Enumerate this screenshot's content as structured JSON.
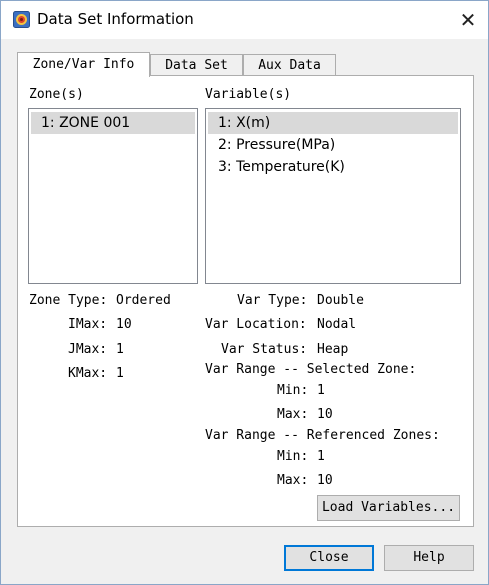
{
  "window": {
    "title": "Data Set Information"
  },
  "tabs": [
    {
      "label": "Zone/Var Info",
      "active": true
    },
    {
      "label": "Data Set",
      "active": false
    },
    {
      "label": "Aux Data",
      "active": false
    }
  ],
  "zones": {
    "header": "Zone(s)",
    "items": [
      {
        "label": "1: ZONE 001",
        "selected": true
      }
    ]
  },
  "variables": {
    "header": "Variable(s)",
    "items": [
      {
        "label": "1: X(m)",
        "selected": true
      },
      {
        "label": "2: Pressure(MPa)",
        "selected": false
      },
      {
        "label": "3: Temperature(K)",
        "selected": false
      }
    ]
  },
  "zone_info": {
    "type_label": "Zone Type:",
    "type_value": "Ordered",
    "imax_label": "IMax:",
    "imax_value": "10",
    "jmax_label": "JMax:",
    "jmax_value": "1",
    "kmax_label": "KMax:",
    "kmax_value": "1"
  },
  "var_info": {
    "type_label": "Var Type:",
    "type_value": "Double",
    "location_label": "Var Location:",
    "location_value": "Nodal",
    "status_label": "Var Status:",
    "status_value": "Heap",
    "range_selected_label": "Var Range -- Selected Zone:",
    "sel_min_label": "Min:",
    "sel_min_value": "1",
    "sel_max_label": "Max:",
    "sel_max_value": "10",
    "range_referenced_label": "Var Range -- Referenced Zones:",
    "ref_min_label": "Min:",
    "ref_min_value": "1",
    "ref_max_label": "Max:",
    "ref_max_value": "10"
  },
  "buttons": {
    "load_variables": "Load Variables...",
    "close": "Close",
    "help": "Help"
  },
  "icons": {
    "app": "tecplot-app-icon",
    "close": "close-icon"
  }
}
